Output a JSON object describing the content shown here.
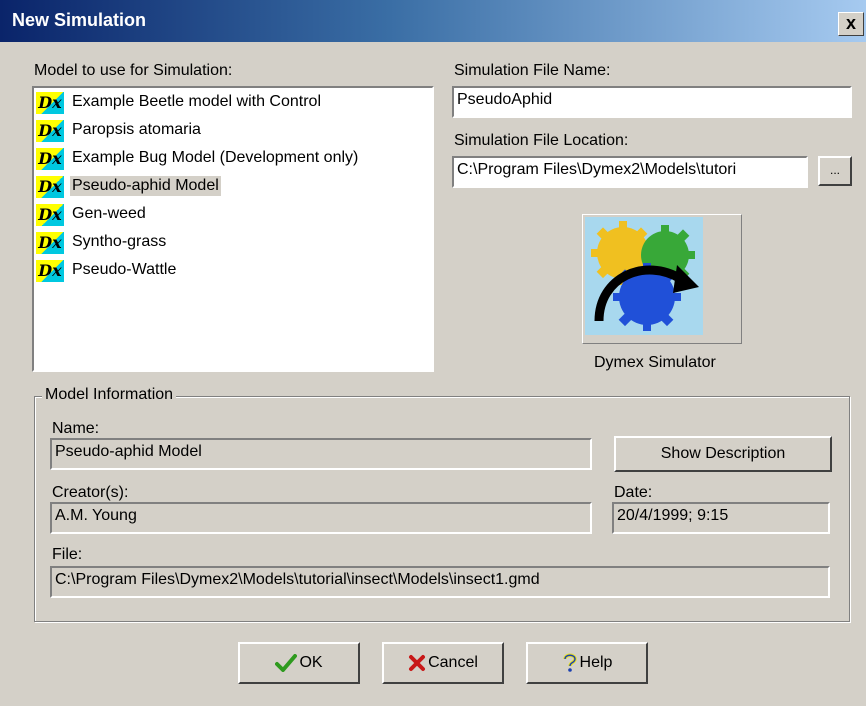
{
  "window": {
    "title": "New Simulation",
    "close_label": "x"
  },
  "model_list": {
    "label": "Model to use for Simulation:",
    "icon_text": "Dx",
    "items": [
      {
        "label": "Example Beetle model with Control"
      },
      {
        "label": "Paropsis atomaria"
      },
      {
        "label": "Example Bug Model (Development only)"
      },
      {
        "label": "Pseudo-aphid Model",
        "selected": true
      },
      {
        "label": "Gen-weed"
      },
      {
        "label": "Syntho-grass"
      },
      {
        "label": "Pseudo-Wattle"
      }
    ]
  },
  "simulation_file": {
    "name_label": "Simulation File Name:",
    "name_value": "PseudoAphid",
    "location_label": "Simulation File Location:",
    "location_value": "C:\\Program Files\\Dymex2\\Models\\tutori",
    "browse_label": "..."
  },
  "simulator": {
    "label": "Dymex Simulator",
    "icon": "dymex-simulator-icon"
  },
  "model_info": {
    "legend": "Model Information",
    "name_label": "Name:",
    "name_value": "Pseudo-aphid Model",
    "show_description_label": "Show Description",
    "creator_label": "Creator(s):",
    "creator_value": "A.M. Young",
    "date_label": "Date:",
    "date_value": "20/4/1999; 9:15",
    "file_label": "File:",
    "file_value": "C:\\Program Files\\Dymex2\\Models\\tutorial\\insect\\Models\\insect1.gmd"
  },
  "buttons": {
    "ok_label": "OK",
    "cancel_label": "Cancel",
    "help_label": "Help"
  },
  "colors": {
    "title_gradient_start": "#0a246a",
    "title_gradient_end": "#a6caf0",
    "dialog_face": "#d4d0c8",
    "ok_check": "#2e9a1e",
    "cancel_x": "#c81818"
  }
}
